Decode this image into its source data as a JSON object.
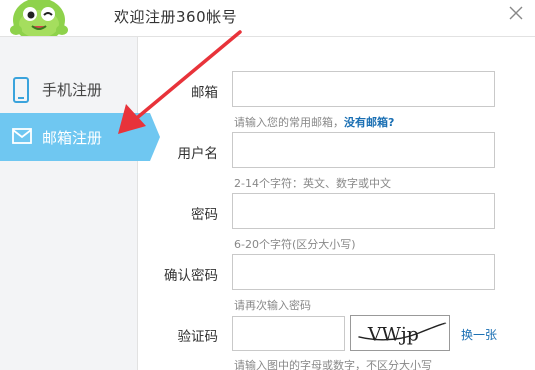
{
  "window": {
    "title": "欢迎注册360帐号"
  },
  "sidebar": {
    "items": [
      {
        "label": "手机注册",
        "icon": "phone-icon"
      },
      {
        "label": "邮箱注册",
        "icon": "mail-icon",
        "active": true
      }
    ]
  },
  "form": {
    "email": {
      "label": "邮箱",
      "value": "",
      "hint": "请输入您的常用邮箱，",
      "hint_link": "没有邮箱?"
    },
    "username": {
      "label": "用户名",
      "value": "",
      "hint": "2-14个字符：英文、数字或中文"
    },
    "password": {
      "label": "密码",
      "value": "",
      "hint": "6-20个字符(区分大小写)"
    },
    "confirm": {
      "label": "确认密码",
      "value": "",
      "hint": "请再次输入密码"
    },
    "captcha": {
      "label": "验证码",
      "value": "",
      "image_text": "VWjp",
      "refresh": "换一张",
      "hint": "请输入图中的字母或数字，不区分大小写"
    }
  },
  "colors": {
    "accent": "#6fc7f1",
    "link": "#1a6fb3",
    "arrow": "#e8333a",
    "mascot": "#8ed24b"
  }
}
